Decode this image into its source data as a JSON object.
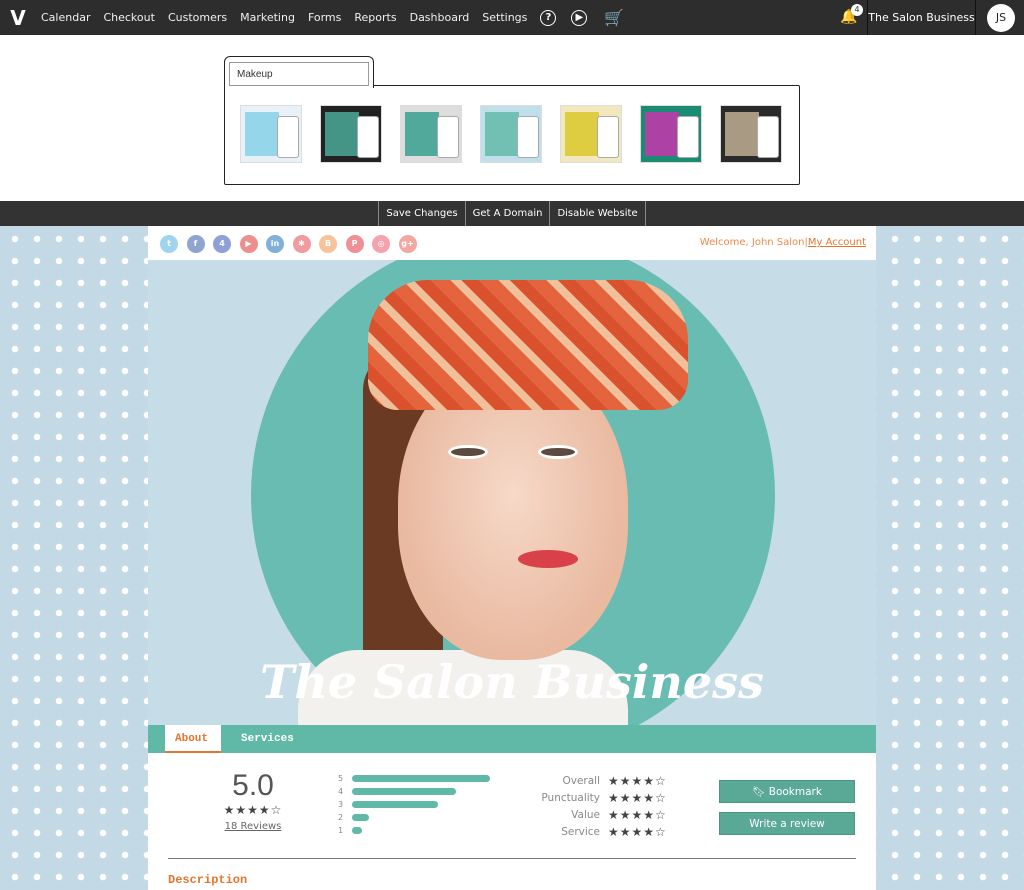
{
  "nav": {
    "items": [
      "Calendar",
      "Checkout",
      "Customers",
      "Marketing",
      "Forms",
      "Reports",
      "Dashboard",
      "Settings"
    ],
    "notification_count": "4",
    "business": "The Salon Business",
    "avatar_initials": "JS"
  },
  "theme_picker": {
    "category_value": "Makeup",
    "thumbnail_count": 7
  },
  "actions": {
    "save": "Save Changes",
    "domain": "Get A Domain",
    "disable": "Disable Website"
  },
  "site": {
    "social": [
      "twitter",
      "facebook",
      "foursquare",
      "youtube",
      "linkedin",
      "yelp",
      "blogger",
      "pinterest",
      "instagram",
      "google-plus"
    ],
    "welcome": "Welcome, John Salon|",
    "my_account": "My Account",
    "title": "The Salon Business",
    "tabs": [
      "About",
      "Services"
    ],
    "rating": {
      "score": "5.0",
      "stars": "★★★★☆",
      "reviews": "18 Reviews",
      "distribution": [
        {
          "label": "5",
          "fill_percent": 100
        },
        {
          "label": "4",
          "fill_percent": 75
        },
        {
          "label": "3",
          "fill_percent": 62
        },
        {
          "label": "2",
          "fill_percent": 12
        },
        {
          "label": "1",
          "fill_percent": 7
        }
      ],
      "categories": [
        {
          "label": "Overall",
          "stars": "★★★★☆"
        },
        {
          "label": "Punctuality",
          "stars": "★★★★☆"
        },
        {
          "label": "Value",
          "stars": "★★★★☆"
        },
        {
          "label": "Service",
          "stars": "★★★★☆"
        }
      ]
    },
    "bookmark": "Bookmark",
    "write_review": "Write a review",
    "description_heading": "Description"
  },
  "colors": {
    "accent": "#60b9a6",
    "orange": "#e2762f",
    "nav": "#2d2d2d"
  }
}
